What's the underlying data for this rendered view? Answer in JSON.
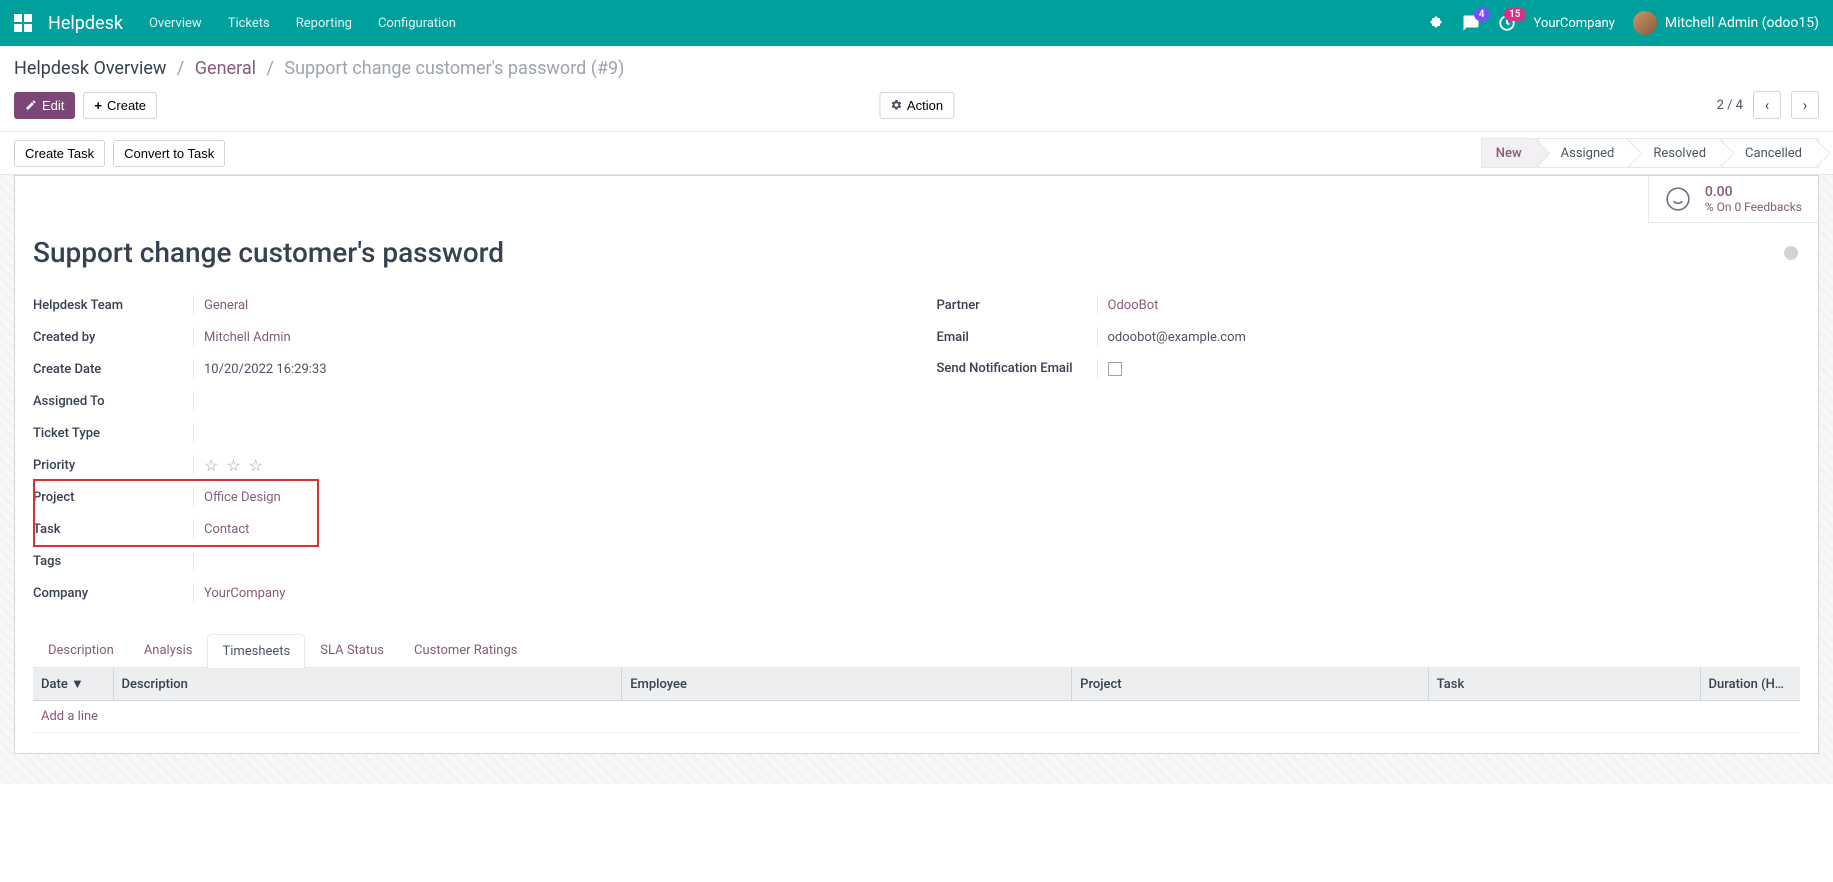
{
  "navbar": {
    "app_name": "Helpdesk",
    "links": [
      "Overview",
      "Tickets",
      "Reporting",
      "Configuration"
    ],
    "conversations_badge": "4",
    "activities_badge": "15",
    "company": "YourCompany",
    "user": "Mitchell Admin (odoo15)"
  },
  "breadcrumb": {
    "root": "Helpdesk Overview",
    "team": "General",
    "current": "Support change customer's password (#9)"
  },
  "toolbar": {
    "edit": "Edit",
    "create": "Create",
    "action": "Action",
    "pager": "2 / 4"
  },
  "status": {
    "create_task": "Create Task",
    "convert_task": "Convert to Task",
    "steps": [
      "New",
      "Assigned",
      "Resolved",
      "Cancelled"
    ],
    "active_index": 0
  },
  "feedback": {
    "value": "0.00",
    "subtitle": "% On 0 Feedbacks"
  },
  "record": {
    "title": "Support change customer's password",
    "fields_left": {
      "helpdesk_team_label": "Helpdesk Team",
      "helpdesk_team_value": "General",
      "created_by_label": "Created by",
      "created_by_value": "Mitchell Admin",
      "create_date_label": "Create Date",
      "create_date_value": "10/20/2022 16:29:33",
      "assigned_to_label": "Assigned To",
      "assigned_to_value": "",
      "ticket_type_label": "Ticket Type",
      "ticket_type_value": "",
      "priority_label": "Priority",
      "project_label": "Project",
      "project_value": "Office Design",
      "task_label": "Task",
      "task_value": "Contact",
      "tags_label": "Tags",
      "tags_value": "",
      "company_label": "Company",
      "company_value": "YourCompany"
    },
    "fields_right": {
      "partner_label": "Partner",
      "partner_value": "OdooBot",
      "email_label": "Email",
      "email_value": "odoobot@example.com",
      "send_notification_label": "Send Notification Email"
    }
  },
  "tabs": [
    "Description",
    "Analysis",
    "Timesheets",
    "SLA Status",
    "Customer Ratings"
  ],
  "tabs_active_index": 2,
  "timesheet_table": {
    "headers": [
      "Date",
      "Description",
      "Employee",
      "Project",
      "Task",
      "Duration (H…"
    ],
    "add_line": "Add a line"
  }
}
